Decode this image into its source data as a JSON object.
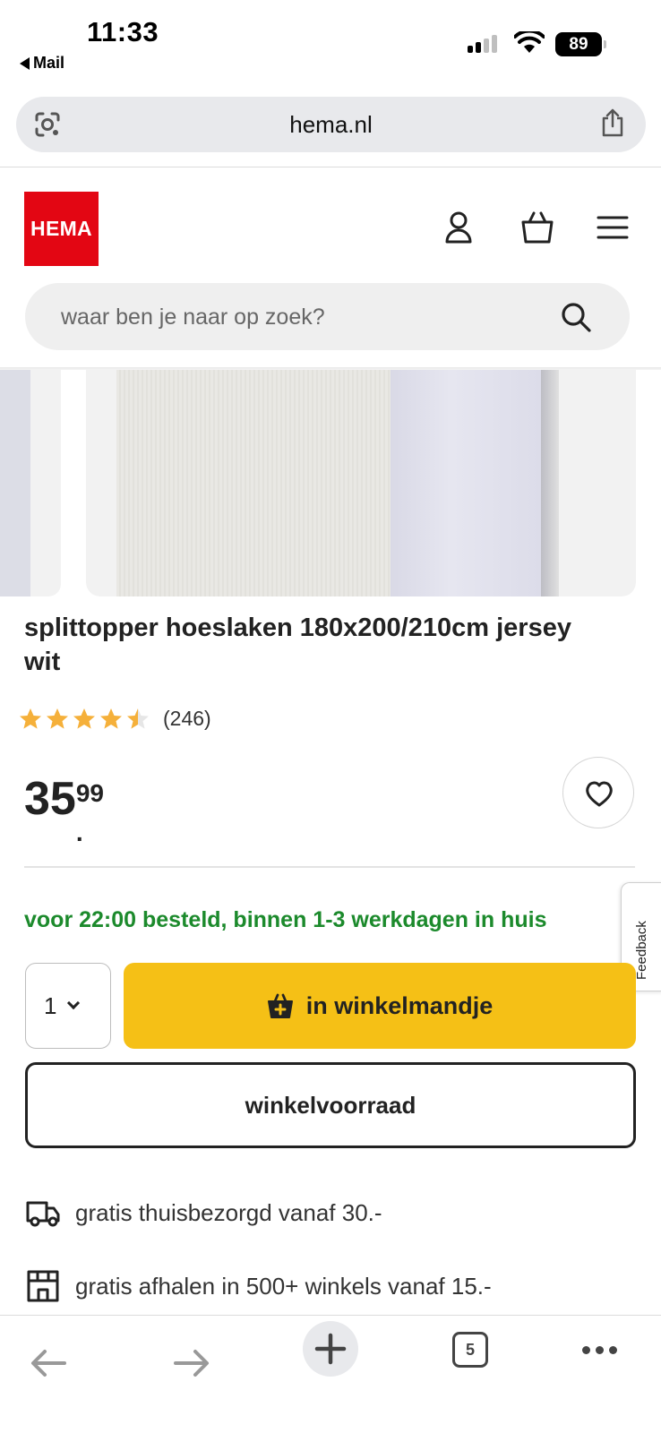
{
  "status_bar": {
    "time": "11:33",
    "back_label": "Mail",
    "battery": "89"
  },
  "browser": {
    "url": "hema.nl",
    "tab_count": "5"
  },
  "header": {
    "logo_text": "HEMA",
    "search_placeholder": "waar ben je naar op zoek?"
  },
  "product": {
    "title": "splittopper hoeslaken 180x200/210cm jersey wit",
    "rating": 4.5,
    "max_rating": 5,
    "reviews": "(246)",
    "price_main": "35",
    "price_cents": "99",
    "delivery_note": "voor 22:00 besteld, binnen 1-3 werkdagen in huis",
    "quantity": "1",
    "add_to_cart_label": "in winkelmandje",
    "store_stock_label": "winkelvoorraad"
  },
  "usps": [
    {
      "icon": "delivery-truck-icon",
      "text": "gratis thuisbezorgd vanaf 30.-"
    },
    {
      "icon": "store-icon",
      "text": "gratis afhalen in 500+ winkels vanaf 15.-"
    }
  ],
  "feedback_label": "Feedback",
  "colors": {
    "brand_red": "#e30613",
    "cta_yellow": "#f5c016",
    "delivery_green": "#1c8a2c",
    "star_orange": "#f5b03a"
  }
}
